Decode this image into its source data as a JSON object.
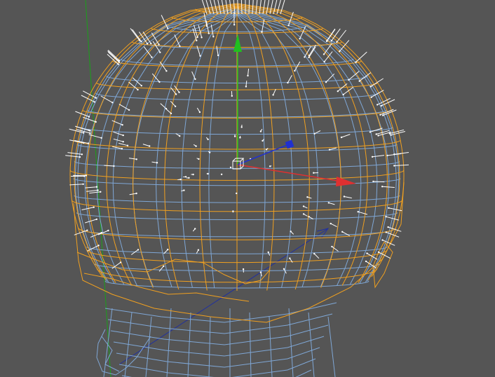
{
  "viewport": {
    "background_color": "#555555"
  },
  "colors": {
    "selected_wire": "#f0a020",
    "unselected_wire": "#7fa7d6",
    "normals": "#ffffff",
    "axis_x": "#e03030",
    "axis_y": "#20c020",
    "axis_z": "#2030d0",
    "world_axis_y": "#1aa01a",
    "world_axis_z": "#2030a0"
  },
  "gizmo": {
    "handles": [
      "x-axis-arrow",
      "y-axis-arrow",
      "z-axis-handle",
      "center-box"
    ]
  },
  "mesh": {
    "object": "head-mesh",
    "selection": "cranium-dome",
    "display": [
      "wireframe",
      "vertex-normals"
    ]
  }
}
